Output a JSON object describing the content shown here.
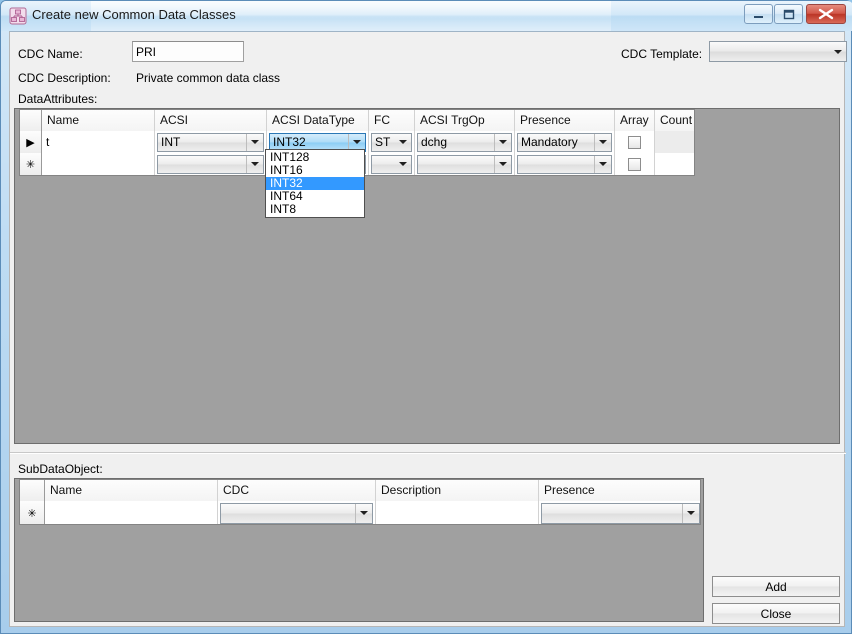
{
  "window": {
    "title": "Create new Common Data Classes",
    "icon": "hierarchy-icon",
    "minimize_label": "Minimize",
    "maximize_label": "Maximize",
    "close_label": "Close",
    "accent_title_bg": "#bcdcf3",
    "close_button_color": "#bb3526"
  },
  "form": {
    "cdc_name_label": "CDC Name:",
    "cdc_name_value": "PRI",
    "cdc_description_label": "CDC Description:",
    "cdc_description_value": "Private common data class",
    "cdc_template_label": "CDC Template:",
    "cdc_template_value": "",
    "data_attributes_label": "DataAttributes:",
    "sub_data_object_label": "SubDataObject:"
  },
  "data_attributes_grid": {
    "columns": [
      "Name",
      "ACSI",
      "ACSI DataType",
      "FC",
      "ACSI TrgOp",
      "Presence",
      "Array",
      "Count"
    ],
    "rows": [
      {
        "marker": "▶",
        "name": "t",
        "acsi": "INT",
        "acsi_datatype": "INT32",
        "fc": "ST",
        "acsi_trgop": "dchg",
        "presence": "Mandatory",
        "array": false,
        "count": ""
      },
      {
        "marker": "✳",
        "name": "",
        "acsi": "",
        "acsi_datatype": "",
        "fc": "",
        "acsi_trgop": "",
        "presence": "",
        "array": false,
        "count": ""
      }
    ]
  },
  "datatype_dropdown": {
    "open": true,
    "selected": "INT32",
    "options": [
      "INT128",
      "INT16",
      "INT32",
      "INT64",
      "INT8"
    ],
    "highlight_color": "#3399ff"
  },
  "sub_data_object_grid": {
    "columns": [
      "Name",
      "CDC",
      "Description",
      "Presence"
    ],
    "rows": [
      {
        "marker": "✳",
        "name": "",
        "cdc": "",
        "description": "",
        "presence": ""
      }
    ]
  },
  "buttons": {
    "add_label": "Add",
    "close_label": "Close"
  }
}
